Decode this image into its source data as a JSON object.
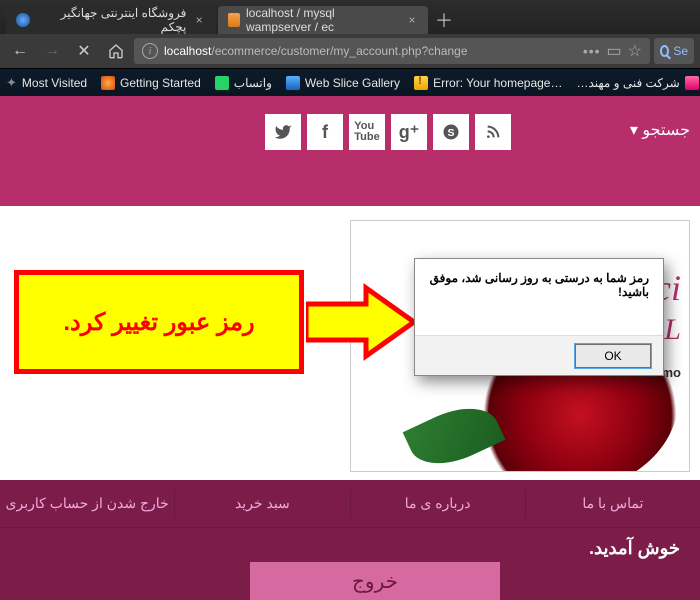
{
  "browser": {
    "tabs": [
      {
        "title": "فروشگاه اینترنتی جهانگیر پچکم",
        "active": false
      },
      {
        "title": "localhost / mysql wampserver / ec",
        "active": true
      }
    ],
    "url_host": "localhost",
    "url_path": "/ecommerce/customer/my_account.php?change",
    "search_stub": "Se"
  },
  "bookmarks": {
    "most_visited": "Most Visited",
    "getting_started": "Getting Started",
    "whatsapp": "واتساب",
    "web_slice": "Web Slice Gallery",
    "error_page": "Error: Your homepage…",
    "company": "شرکت فنی و مهند…"
  },
  "header": {
    "search_toggle": "جستجو"
  },
  "promo": {
    "line1": "Speci",
    "line2": "10% L",
    "line3": "only this mo"
  },
  "nav": {
    "items": [
      "تماس با ما",
      "درباره ی ما",
      "سبد خرید",
      "خارج شدن از حساب کاربری"
    ],
    "welcome": "خوش آمدید.",
    "logout": "خروج"
  },
  "callout": {
    "text": "رمز عبور تغییر کرد."
  },
  "alert": {
    "message": "رمز شما به درستی به روز رسانی شد، موفق باشید!",
    "ok": "OK"
  }
}
